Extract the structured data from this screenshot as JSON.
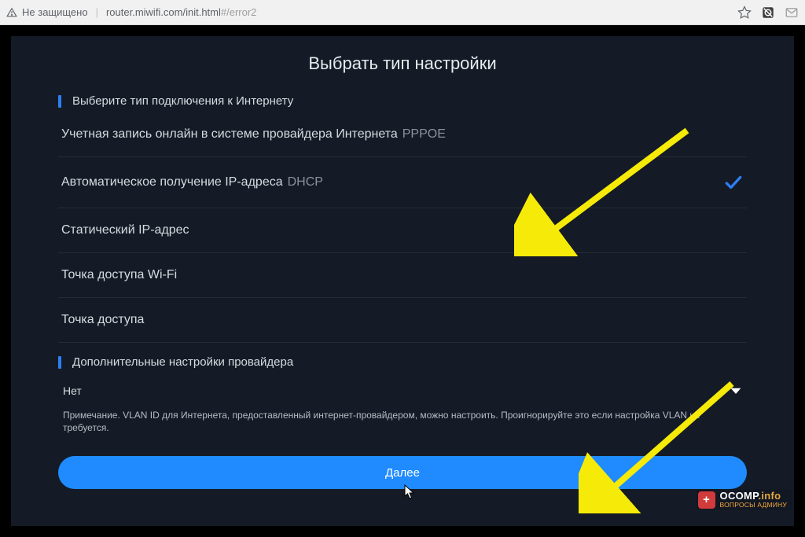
{
  "browser": {
    "security_label": "Не защищено",
    "url_main": "router.miwifi.com/init.html",
    "url_hash": "#/error2"
  },
  "page": {
    "title": "Выбрать тип настройки"
  },
  "section1": {
    "title": "Выберите тип подключения к Интернету"
  },
  "options": [
    {
      "label": "Учетная запись онлайн в системе провайдера Интернета",
      "suffix": "PPPOE",
      "selected": false
    },
    {
      "label": "Автоматическое получение IP-адреса",
      "suffix": "DHCP",
      "selected": true
    },
    {
      "label": "Статический IP-адрес",
      "suffix": "",
      "selected": false
    },
    {
      "label": "Точка доступа Wi-Fi",
      "suffix": "",
      "selected": false
    },
    {
      "label": "Точка доступа",
      "suffix": "",
      "selected": false
    }
  ],
  "section2": {
    "title": "Дополнительные настройки провайдера"
  },
  "provider_select": {
    "value": "Нет"
  },
  "note": "Примечание. VLAN ID для Интернета, предоставленный интернет-провайдером, можно настроить. Проигнорируйте это если настройка VLAN не требуется.",
  "primary_button": "Далее",
  "watermark": {
    "brand": "OCOMP",
    "brand_suffix": ".info",
    "tagline": "ВОПРОСЫ АДМИНУ"
  }
}
